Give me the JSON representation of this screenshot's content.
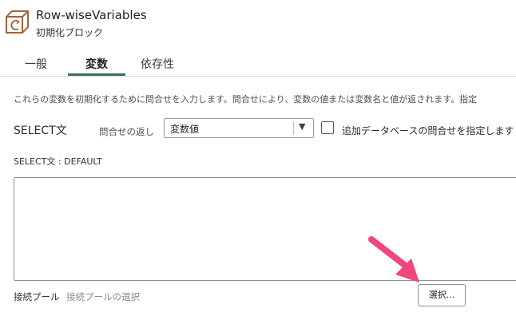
{
  "header": {
    "title": "Row-wiseVariables",
    "subtitle": "初期化ブロック",
    "icon": "initialization-block-icon",
    "icon_color": "#a0643a"
  },
  "tabs": [
    {
      "label": "一般",
      "active": false
    },
    {
      "label": "変数",
      "active": true
    },
    {
      "label": "依存性",
      "active": false
    }
  ],
  "accent_color": "#3e6e5a",
  "description": "これらの変数を初期化するために問合せを入力します。問合せにより、変数の値または変数名と値が返されます。指定",
  "select": {
    "label": "SELECT文",
    "returns_label": "問合せの返し",
    "returns_value": "変数値",
    "checkbox_label": "追加データベースの問合せを指定します",
    "checkbox_checked": false,
    "default_label": "SELECT文 : DEFAULT",
    "query_text": ""
  },
  "connection_pool": {
    "label": "接続プール",
    "placeholder": "接続プールの選択",
    "select_button": "選択..."
  },
  "annotation": {
    "arrow_color": "#f0467a",
    "icon": "pointer-arrow-icon"
  }
}
